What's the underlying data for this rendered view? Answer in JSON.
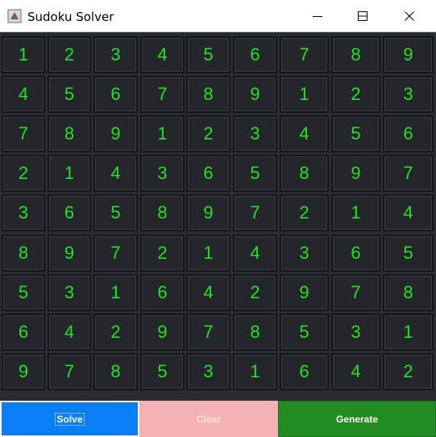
{
  "window": {
    "title": "Sudoku Solver",
    "icon": "app-icon",
    "controls": [
      "minimize-icon",
      "maximize-icon",
      "close-icon"
    ]
  },
  "colors": {
    "digit": "#21e321",
    "cell_background": "#24262b",
    "solve_button": "#0a7ef7",
    "clear_button": "#f4b2b2",
    "generate_button": "#228b22"
  },
  "grid": [
    [
      "1",
      "2",
      "3",
      "4",
      "5",
      "6",
      "7",
      "8",
      "9"
    ],
    [
      "4",
      "5",
      "6",
      "7",
      "8",
      "9",
      "1",
      "2",
      "3"
    ],
    [
      "7",
      "8",
      "9",
      "1",
      "2",
      "3",
      "4",
      "5",
      "6"
    ],
    [
      "2",
      "1",
      "4",
      "3",
      "6",
      "5",
      "8",
      "9",
      "7"
    ],
    [
      "3",
      "6",
      "5",
      "8",
      "9",
      "7",
      "2",
      "1",
      "4"
    ],
    [
      "8",
      "9",
      "7",
      "2",
      "1",
      "4",
      "3",
      "6",
      "5"
    ],
    [
      "5",
      "3",
      "1",
      "6",
      "4",
      "2",
      "9",
      "7",
      "8"
    ],
    [
      "6",
      "4",
      "2",
      "9",
      "7",
      "8",
      "5",
      "3",
      "1"
    ],
    [
      "9",
      "7",
      "8",
      "5",
      "3",
      "1",
      "6",
      "4",
      "2"
    ]
  ],
  "buttons": {
    "solve_label": "Solve",
    "clear_label": "Clear",
    "generate_label": "Generate"
  }
}
